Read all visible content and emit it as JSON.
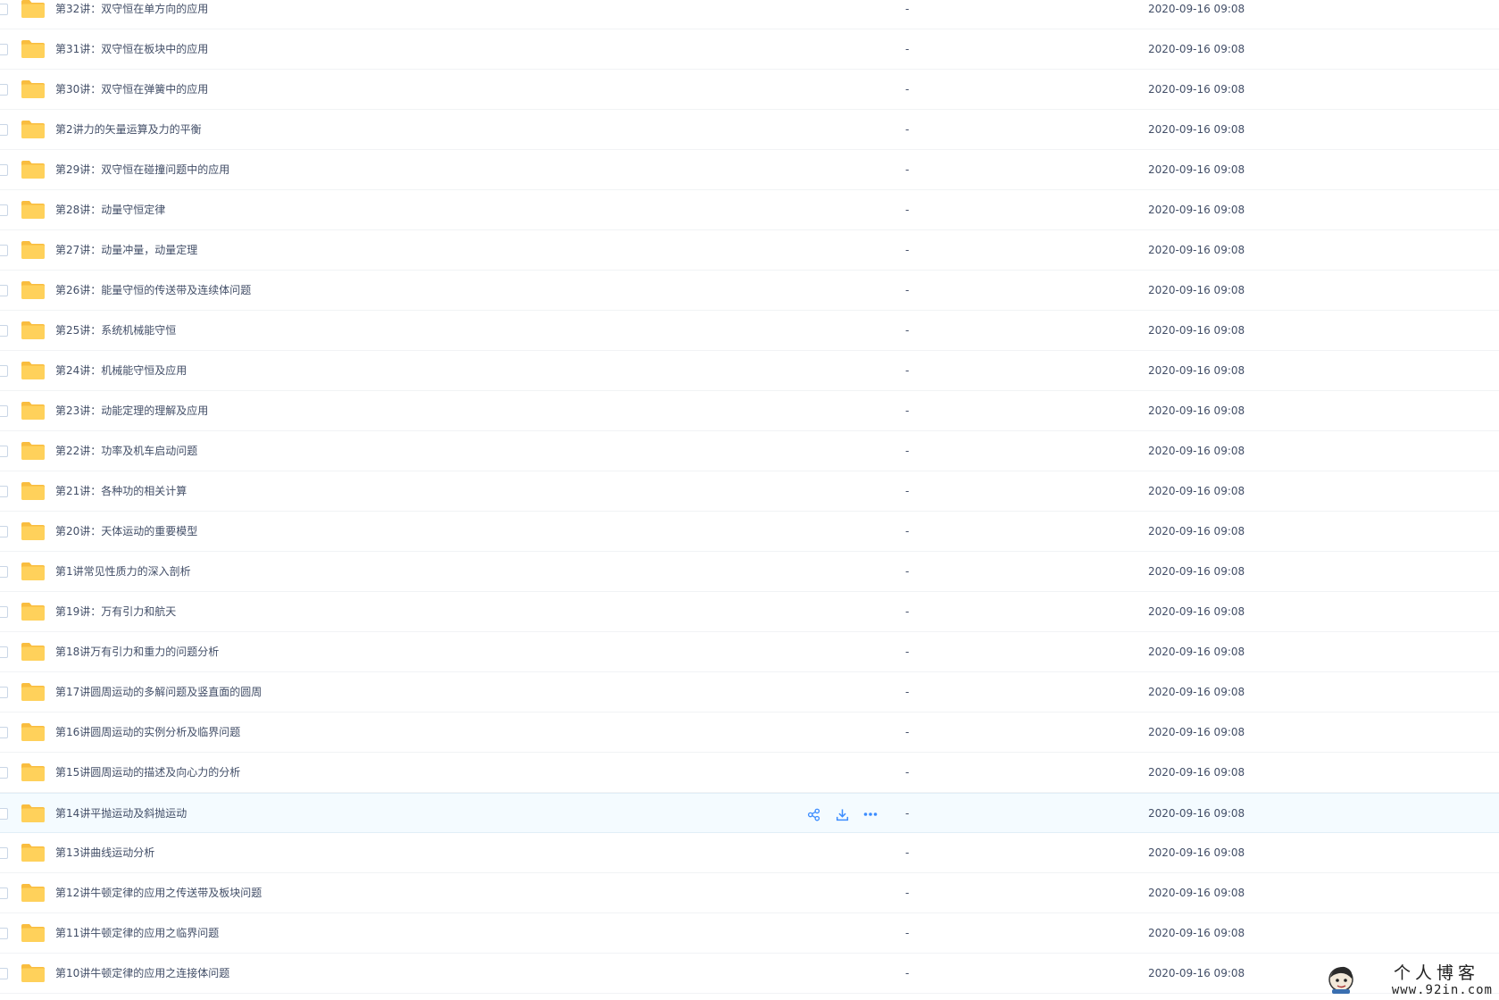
{
  "icons": {
    "folder": "folder-icon",
    "share": "share-icon",
    "download": "download-icon",
    "more": "more-icon"
  },
  "colors": {
    "folder": "#ffd15b",
    "folder_tab": "#f9bd3f",
    "action_blue": "#3b8cff",
    "row_hover": "#f4fbff",
    "text": "#424e67"
  },
  "files": [
    {
      "name": "第32讲：双守恒在单方向的应用",
      "size": "-",
      "modified": "2020-09-16 09:08"
    },
    {
      "name": "第31讲：双守恒在板块中的应用",
      "size": "-",
      "modified": "2020-09-16 09:08"
    },
    {
      "name": "第30讲：双守恒在弹簧中的应用",
      "size": "-",
      "modified": "2020-09-16 09:08"
    },
    {
      "name": "第2讲力的矢量运算及力的平衡",
      "size": "-",
      "modified": "2020-09-16 09:08"
    },
    {
      "name": "第29讲：双守恒在碰撞问题中的应用",
      "size": "-",
      "modified": "2020-09-16 09:08"
    },
    {
      "name": "第28讲：动量守恒定律",
      "size": "-",
      "modified": "2020-09-16 09:08"
    },
    {
      "name": "第27讲：动量冲量，动量定理",
      "size": "-",
      "modified": "2020-09-16 09:08"
    },
    {
      "name": "第26讲：能量守恒的传送带及连续体问题",
      "size": "-",
      "modified": "2020-09-16 09:08"
    },
    {
      "name": "第25讲：系统机械能守恒",
      "size": "-",
      "modified": "2020-09-16 09:08"
    },
    {
      "name": "第24讲：机械能守恒及应用",
      "size": "-",
      "modified": "2020-09-16 09:08"
    },
    {
      "name": "第23讲：动能定理的理解及应用",
      "size": "-",
      "modified": "2020-09-16 09:08"
    },
    {
      "name": "第22讲：功率及机车启动问题",
      "size": "-",
      "modified": "2020-09-16 09:08"
    },
    {
      "name": "第21讲：各种功的相关计算",
      "size": "-",
      "modified": "2020-09-16 09:08"
    },
    {
      "name": "第20讲：天体运动的重要模型",
      "size": "-",
      "modified": "2020-09-16 09:08"
    },
    {
      "name": "第1讲常见性质力的深入剖析",
      "size": "-",
      "modified": "2020-09-16 09:08"
    },
    {
      "name": "第19讲：万有引力和航天",
      "size": "-",
      "modified": "2020-09-16 09:08"
    },
    {
      "name": "第18讲万有引力和重力的问题分析",
      "size": "-",
      "modified": "2020-09-16 09:08"
    },
    {
      "name": "第17讲圆周运动的多解问题及竖直面的圆周",
      "size": "-",
      "modified": "2020-09-16 09:08"
    },
    {
      "name": "第16讲圆周运动的实例分析及临界问题",
      "size": "-",
      "modified": "2020-09-16 09:08"
    },
    {
      "name": "第15讲圆周运动的描述及向心力的分析",
      "size": "-",
      "modified": "2020-09-16 09:08"
    },
    {
      "name": "第14讲平抛运动及斜抛运动",
      "size": "-",
      "modified": "2020-09-16 09:08",
      "hovered": true
    },
    {
      "name": "第13讲曲线运动分析",
      "size": "-",
      "modified": "2020-09-16 09:08"
    },
    {
      "name": "第12讲牛顿定律的应用之传送带及板块问题",
      "size": "-",
      "modified": "2020-09-16 09:08"
    },
    {
      "name": "第11讲牛顿定律的应用之临界问题",
      "size": "-",
      "modified": "2020-09-16 09:08"
    },
    {
      "name": "第10讲牛顿定律的应用之连接体问题",
      "size": "-",
      "modified": "2020-09-16 09:08"
    }
  ],
  "watermark": {
    "title": "个人博客",
    "url": "www.92in.com"
  }
}
